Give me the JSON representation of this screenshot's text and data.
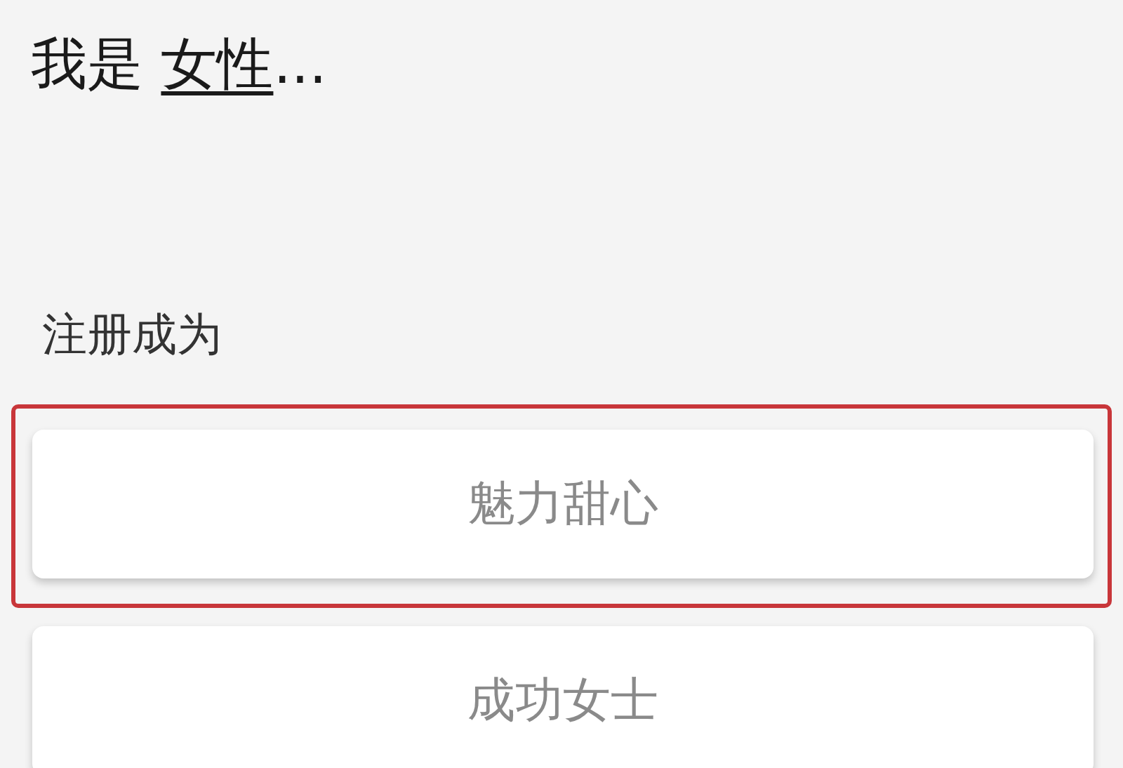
{
  "heading": {
    "prefix": "我是",
    "choice": "女性",
    "suffix": "..."
  },
  "register_label": "注册成为",
  "options": [
    {
      "label": "魅力甜心",
      "highlighted": true
    },
    {
      "label": "成功女士",
      "highlighted": false
    }
  ]
}
